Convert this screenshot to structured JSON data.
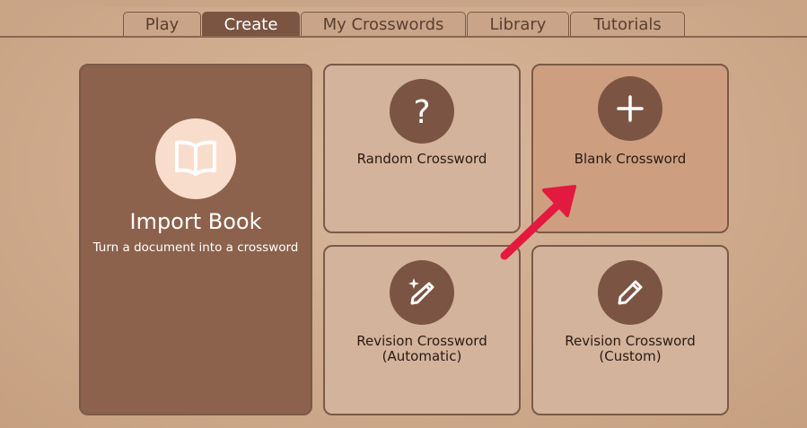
{
  "tabs": [
    {
      "label": "Play"
    },
    {
      "label": "Create"
    },
    {
      "label": "My Crosswords"
    },
    {
      "label": "Library"
    },
    {
      "label": "Tutorials"
    }
  ],
  "active_tab": "Create",
  "cards": {
    "import_book": {
      "title": "Import Book",
      "subtitle": "Turn a document into a crossword",
      "icon": "open-book-icon"
    },
    "random": {
      "label": "Random Crossword",
      "icon": "question-mark-icon"
    },
    "blank": {
      "label": "Blank Crossword",
      "icon": "plus-icon"
    },
    "revision_auto": {
      "line1": "Revision Crossword",
      "line2": "(Automatic)",
      "icon": "magic-pencil-icon"
    },
    "revision_custom": {
      "line1": "Revision Crossword",
      "line2": "(Custom)",
      "icon": "pencil-icon"
    }
  },
  "colors": {
    "accent": "#7b5442",
    "highlight_card": "#cd9f80",
    "arrow": "#e3193f"
  }
}
